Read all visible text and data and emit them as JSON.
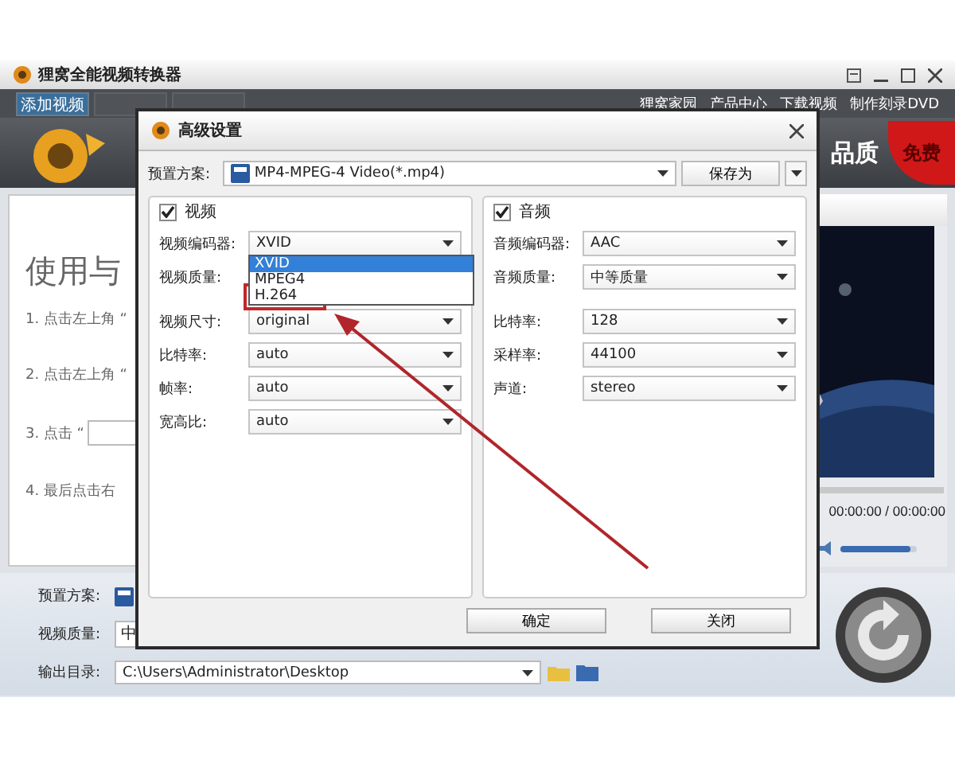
{
  "app": {
    "title": "狸窝全能视频转换器"
  },
  "toolbar": {
    "tabs": [
      {
        "label": "添加视频",
        "disabled": false
      },
      {
        "disabled": true
      },
      {
        "disabled": true
      }
    ],
    "links": [
      "狸窝家园",
      "产品中心",
      "下载视频",
      "制作刻录DVD"
    ]
  },
  "banner": {
    "slogan": "品质",
    "badge": "免费"
  },
  "guide": {
    "heading": "使用与",
    "steps": [
      {
        "kind": "text",
        "text": "1. 点击左上角 “"
      },
      {
        "kind": "text",
        "text": "2. 点击左上角 “"
      },
      {
        "kind": "field",
        "text": "3. 点击 “"
      },
      {
        "kind": "text",
        "text": "4. 最后点击右"
      }
    ]
  },
  "player": {
    "time": "00:00:00 / 00:00:00",
    "volume": {
      "level": 0.92
    }
  },
  "output": {
    "preset_label": "预置方案:",
    "quality_label": "视频质量:",
    "quality_value": "中",
    "dir_label": "输出目录:",
    "dir_value": "C:\\Users\\Administrator\\Desktop"
  },
  "dialog": {
    "title": "高级设置",
    "preset_label": "预置方案:",
    "preset_value": "MP4-MPEG-4 Video(*.mp4)",
    "save_button": "保存为",
    "video": {
      "title": "视频",
      "checked": true,
      "fields": [
        {
          "label": "视频编码器:",
          "value": "XVID",
          "expanded": true,
          "options": [
            {
              "label": "XVID",
              "selected": true
            },
            {
              "label": "MPEG4",
              "selected": false
            },
            {
              "label": "H.264",
              "selected": false
            }
          ]
        },
        {
          "label": "视频质量:"
        },
        {
          "label": "视频尺寸:",
          "value": "original"
        },
        {
          "label": "比特率:",
          "value": "auto"
        },
        {
          "label": "帧率:",
          "value": "auto"
        },
        {
          "label": "宽高比:",
          "value": "auto"
        }
      ]
    },
    "audio": {
      "title": "音频",
      "checked": true,
      "fields": [
        {
          "label": "音频编码器:",
          "value": "AAC"
        },
        {
          "label": "音频质量:",
          "value": "中等质量"
        },
        {
          "label": "比特率:",
          "value": "128"
        },
        {
          "label": "采样率:",
          "value": "44100"
        },
        {
          "label": "声道:",
          "value": "stereo"
        }
      ]
    },
    "buttons": [
      "确定",
      "关闭"
    ]
  }
}
